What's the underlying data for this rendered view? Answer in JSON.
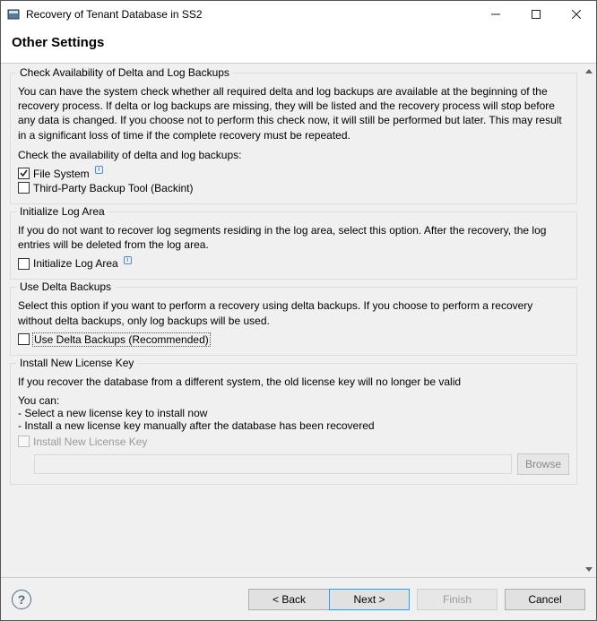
{
  "window": {
    "title": "Recovery of Tenant Database in SS2",
    "page_title": "Other Settings"
  },
  "groups": {
    "check_avail": {
      "title": "Check Availability of Delta and Log Backups",
      "desc": "You can have the system check whether all required delta and log backups are available at the beginning of the recovery process. If delta or log backups are missing, they will be listed and the recovery process will stop before any data is changed. If you choose not to perform this check now, it will still be performed but later. This may result in a significant loss of time if the complete recovery must be repeated.",
      "prompt": "Check the availability of delta and log backups:",
      "file_system_label": "File System",
      "backint_label": "Third-Party Backup Tool (Backint)"
    },
    "init_log": {
      "title": "Initialize Log Area",
      "desc": "If you do not want to recover log segments residing in the log area, select this option. After the recovery, the log entries will be deleted from the log area.",
      "check_label": "Initialize Log Area"
    },
    "use_delta": {
      "title": "Use Delta Backups",
      "desc": "Select this option if you want to perform a recovery using delta backups. If you choose to perform a recovery without delta backups, only log backups will be used.",
      "check_label": "Use Delta Backups (Recommended)"
    },
    "license": {
      "title": "Install New License Key",
      "desc": "If you recover the database from a different system, the old license key will no longer be valid",
      "you_can": "You can:",
      "bullet1": "- Select a new license key to install now",
      "bullet2": "- Install a new license key manually after the database has been recovered",
      "check_label": "Install New License Key",
      "browse_label": "Browse"
    }
  },
  "footer": {
    "back": "< Back",
    "next": "Next >",
    "finish": "Finish",
    "cancel": "Cancel"
  }
}
